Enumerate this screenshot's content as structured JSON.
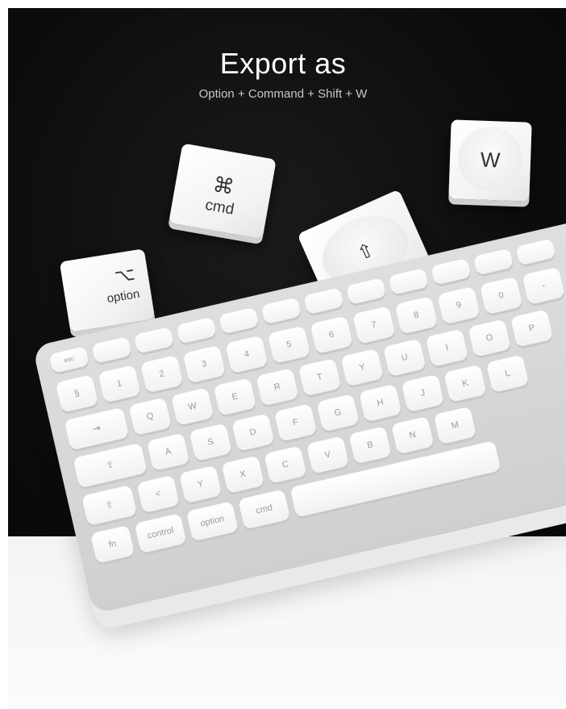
{
  "header": {
    "title": "Export as",
    "subtitle": "Option + Command + Shift + W"
  },
  "floating_keys": {
    "option": {
      "glyph": "⌥",
      "label": "option"
    },
    "cmd": {
      "glyph": "⌘",
      "label": "cmd"
    },
    "shift": {
      "glyph": "⇧"
    },
    "w": {
      "label": "W"
    }
  },
  "keyboard": {
    "rows": [
      [
        "esc",
        "",
        "",
        "",
        "",
        "",
        "",
        "",
        "",
        "",
        "",
        ""
      ],
      [
        "§",
        "1",
        "2",
        "3",
        "4",
        "5",
        "6",
        "7",
        "8",
        "9",
        "0",
        "-"
      ],
      [
        "⇥",
        "Q",
        "W",
        "E",
        "R",
        "T",
        "Y",
        "U",
        "I",
        "O",
        "P"
      ],
      [
        "⇪",
        "A",
        "S",
        "D",
        "F",
        "G",
        "H",
        "J",
        "K",
        "L"
      ],
      [
        "⇧",
        "<",
        "Y",
        "X",
        "C",
        "V",
        "B",
        "N",
        "M"
      ],
      [
        "fn",
        "control",
        "option",
        "cmd",
        ""
      ]
    ]
  },
  "colors": {
    "backdrop": "#0d0d0d",
    "keycap": "#f5f5f5",
    "title_text": "#ffffff"
  }
}
